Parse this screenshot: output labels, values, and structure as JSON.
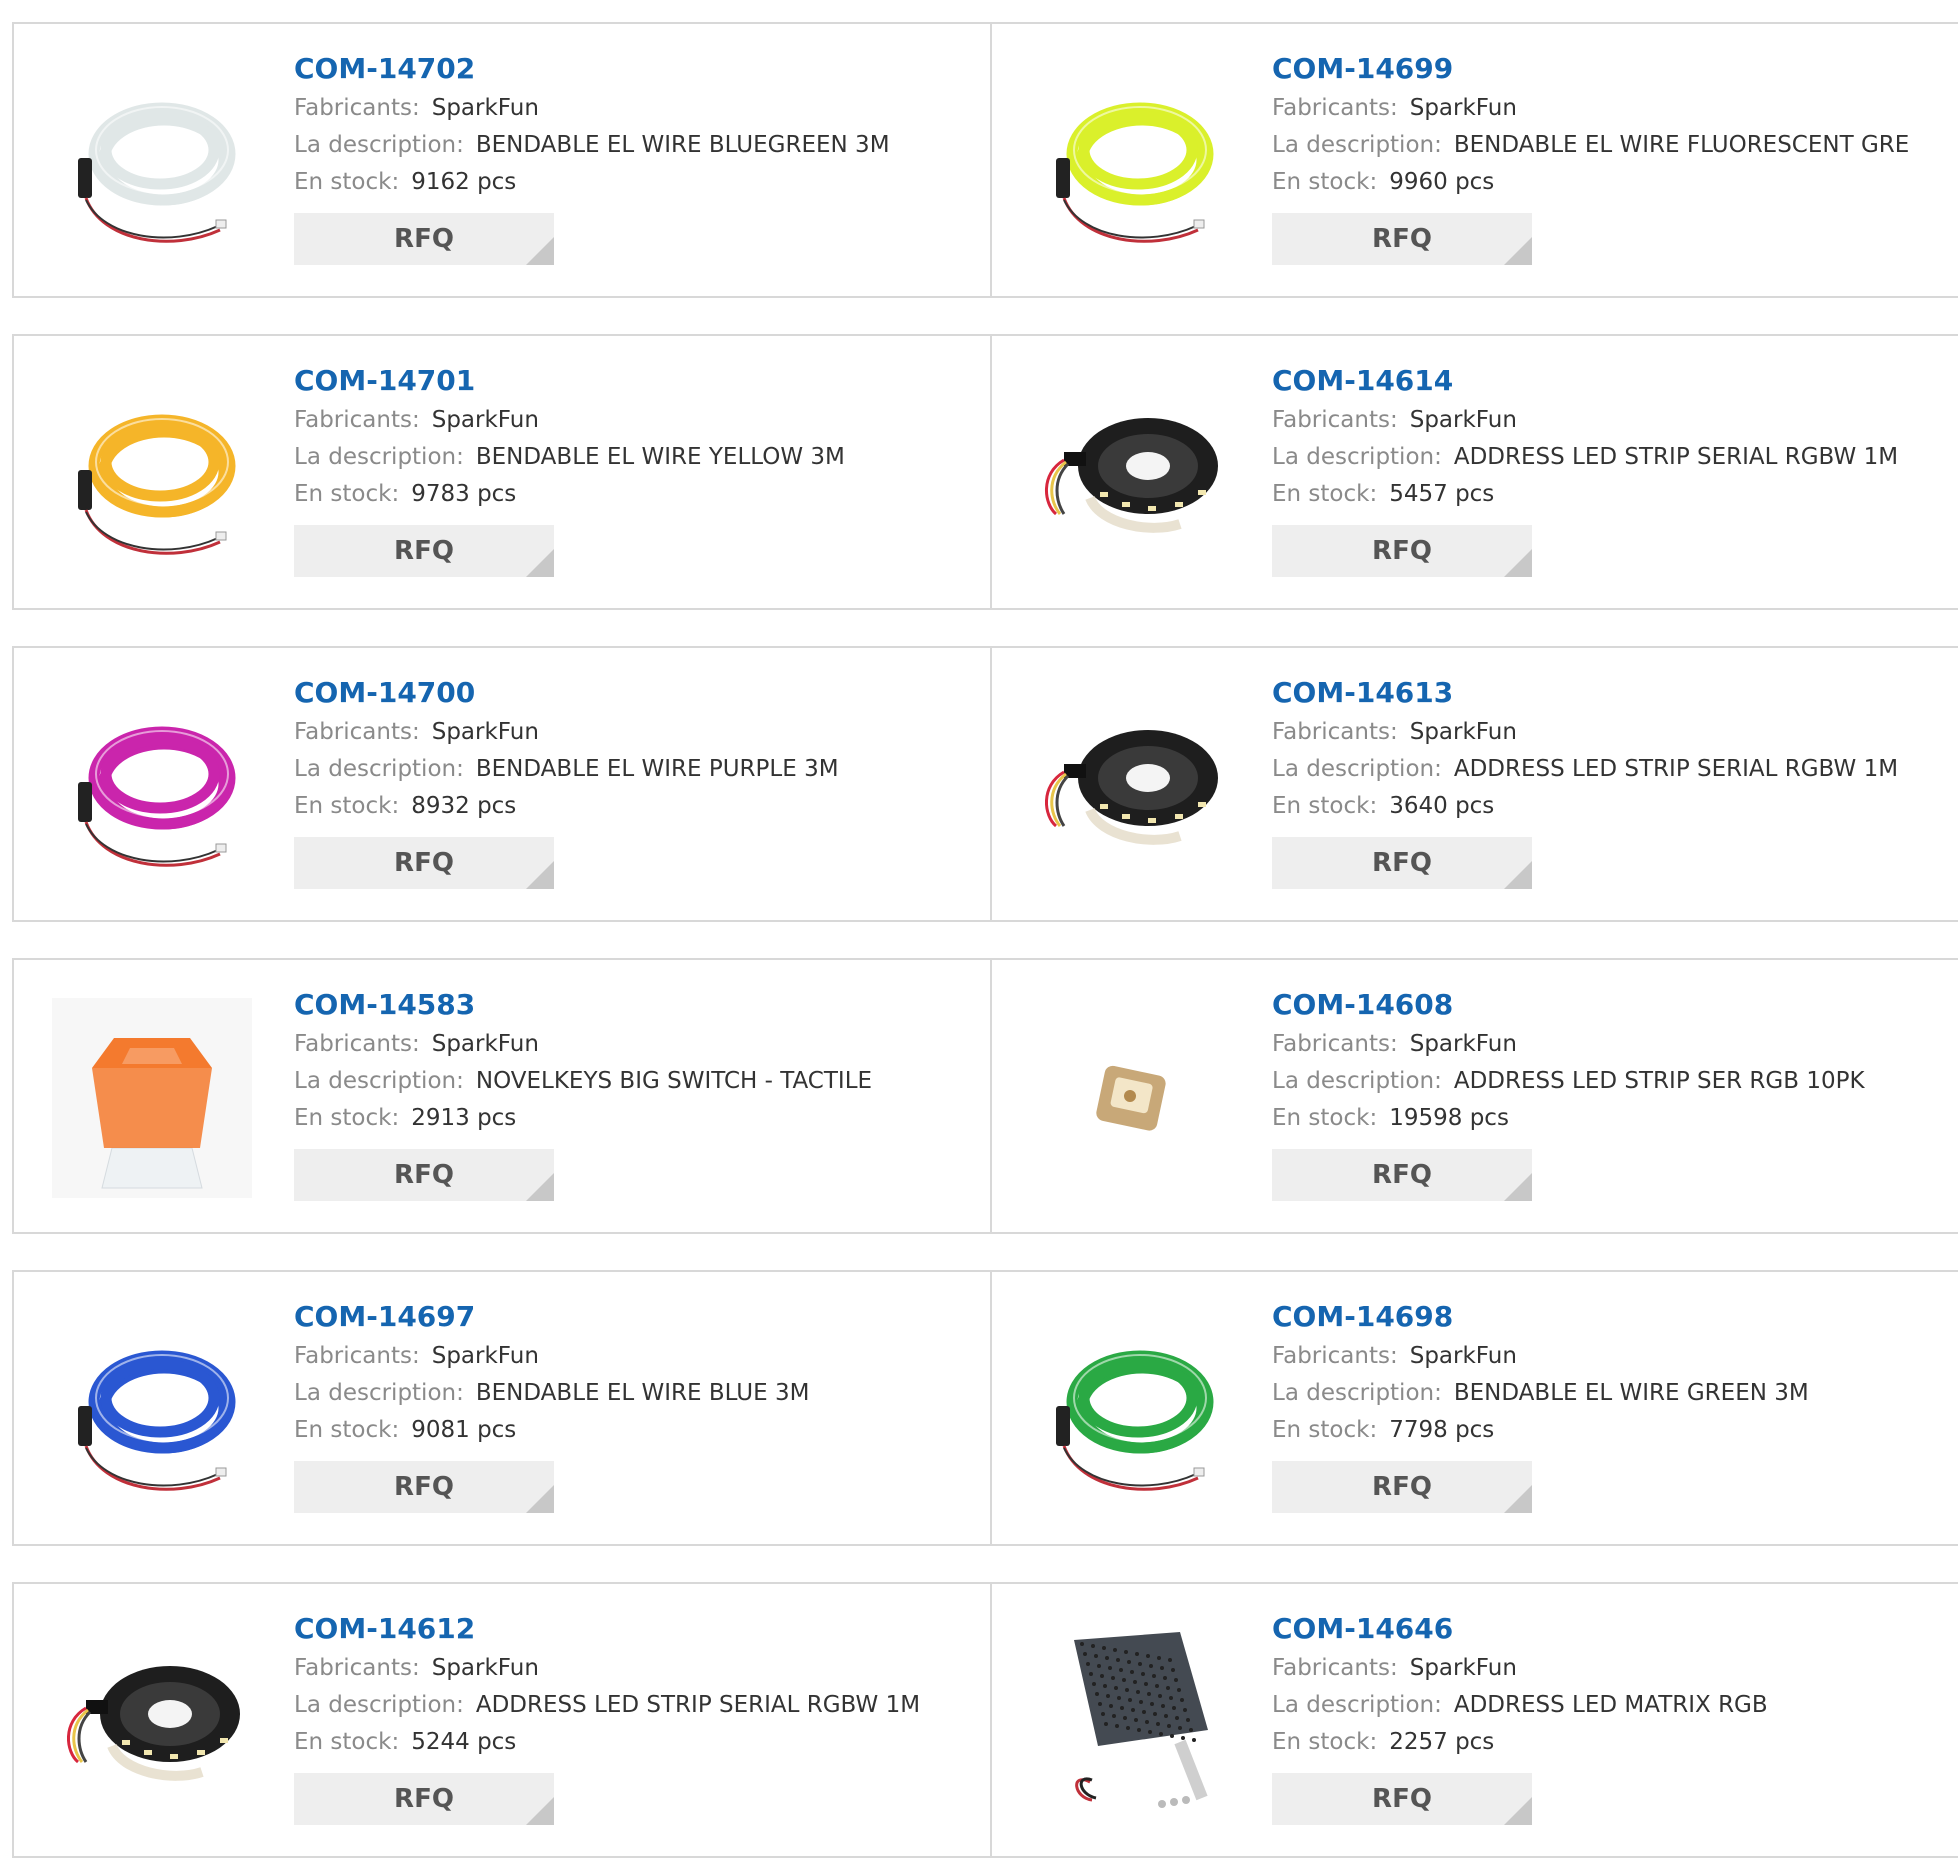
{
  "labels": {
    "manufacturer": "Fabricants:",
    "description": "La description:",
    "stock": "En stock:",
    "rfq": "RFQ"
  },
  "products": [
    {
      "pn": "COM-14702",
      "manufacturer": "SparkFun",
      "description": "BENDABLE EL WIRE BLUEGREEN 3M",
      "stock": "9162 pcs",
      "image": "el-wire-coil",
      "color": "#dfe6e6"
    },
    {
      "pn": "COM-14699",
      "manufacturer": "SparkFun",
      "description": "BENDABLE EL WIRE FLUORESCENT GRE",
      "stock": "9960 pcs",
      "image": "el-wire-coil",
      "color": "#d9f020"
    },
    {
      "pn": "COM-14701",
      "manufacturer": "SparkFun",
      "description": "BENDABLE EL WIRE YELLOW 3M",
      "stock": "9783 pcs",
      "image": "el-wire-coil",
      "color": "#f5b21e"
    },
    {
      "pn": "COM-14614",
      "manufacturer": "SparkFun",
      "description": "ADDRESS LED STRIP SERIAL RGBW 1M",
      "stock": "5457 pcs",
      "image": "led-strip-reel",
      "color": "#2a2a2a"
    },
    {
      "pn": "COM-14700",
      "manufacturer": "SparkFun",
      "description": "BENDABLE EL WIRE PURPLE 3M",
      "stock": "8932 pcs",
      "image": "el-wire-coil",
      "color": "#c81aa8"
    },
    {
      "pn": "COM-14613",
      "manufacturer": "SparkFun",
      "description": "ADDRESS LED STRIP SERIAL RGBW 1M",
      "stock": "3640 pcs",
      "image": "led-strip-reel",
      "color": "#2a2a2a"
    },
    {
      "pn": "COM-14583",
      "manufacturer": "SparkFun",
      "description": "NOVELKEYS BIG SWITCH - TACTILE",
      "stock": "2913 pcs",
      "image": "big-switch",
      "color": "#f47a2e"
    },
    {
      "pn": "COM-14608",
      "manufacturer": "SparkFun",
      "description": "ADDRESS LED STRIP SER RGB 10PK",
      "stock": "19598 pcs",
      "image": "led-chip",
      "color": "#c8a878"
    },
    {
      "pn": "COM-14697",
      "manufacturer": "SparkFun",
      "description": "BENDABLE EL WIRE BLUE 3M",
      "stock": "9081 pcs",
      "image": "el-wire-coil",
      "color": "#1f4fd0"
    },
    {
      "pn": "COM-14698",
      "manufacturer": "SparkFun",
      "description": "BENDABLE EL WIRE GREEN 3M",
      "stock": "7798 pcs",
      "image": "el-wire-coil",
      "color": "#1fa53a"
    },
    {
      "pn": "COM-14612",
      "manufacturer": "SparkFun",
      "description": "ADDRESS LED STRIP SERIAL RGBW 1M",
      "stock": "5244 pcs",
      "image": "led-strip-reel",
      "color": "#2a2a2a"
    },
    {
      "pn": "COM-14646",
      "manufacturer": "SparkFun",
      "description": "ADDRESS LED MATRIX RGB",
      "stock": "2257 pcs",
      "image": "led-matrix-panel",
      "color": "#444a52"
    }
  ]
}
